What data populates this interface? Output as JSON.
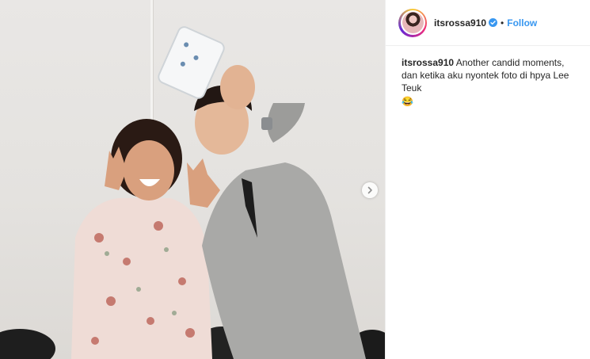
{
  "post": {
    "media": {
      "description_icon": "photo",
      "next_icon": "chevron-right-icon"
    },
    "header": {
      "username": "itsrossa910",
      "verified_icon": "verified-badge-icon",
      "separator": "•",
      "follow_label": "Follow"
    },
    "caption": {
      "username": "itsrossa910",
      "text": "Another candid moments, dan ketika aku nyontek foto di hpya Lee Teuk",
      "emoji": "😂"
    }
  },
  "colors": {
    "follow_blue": "#3897f0",
    "text": "#262626",
    "verified_blue": "#3897f0"
  }
}
